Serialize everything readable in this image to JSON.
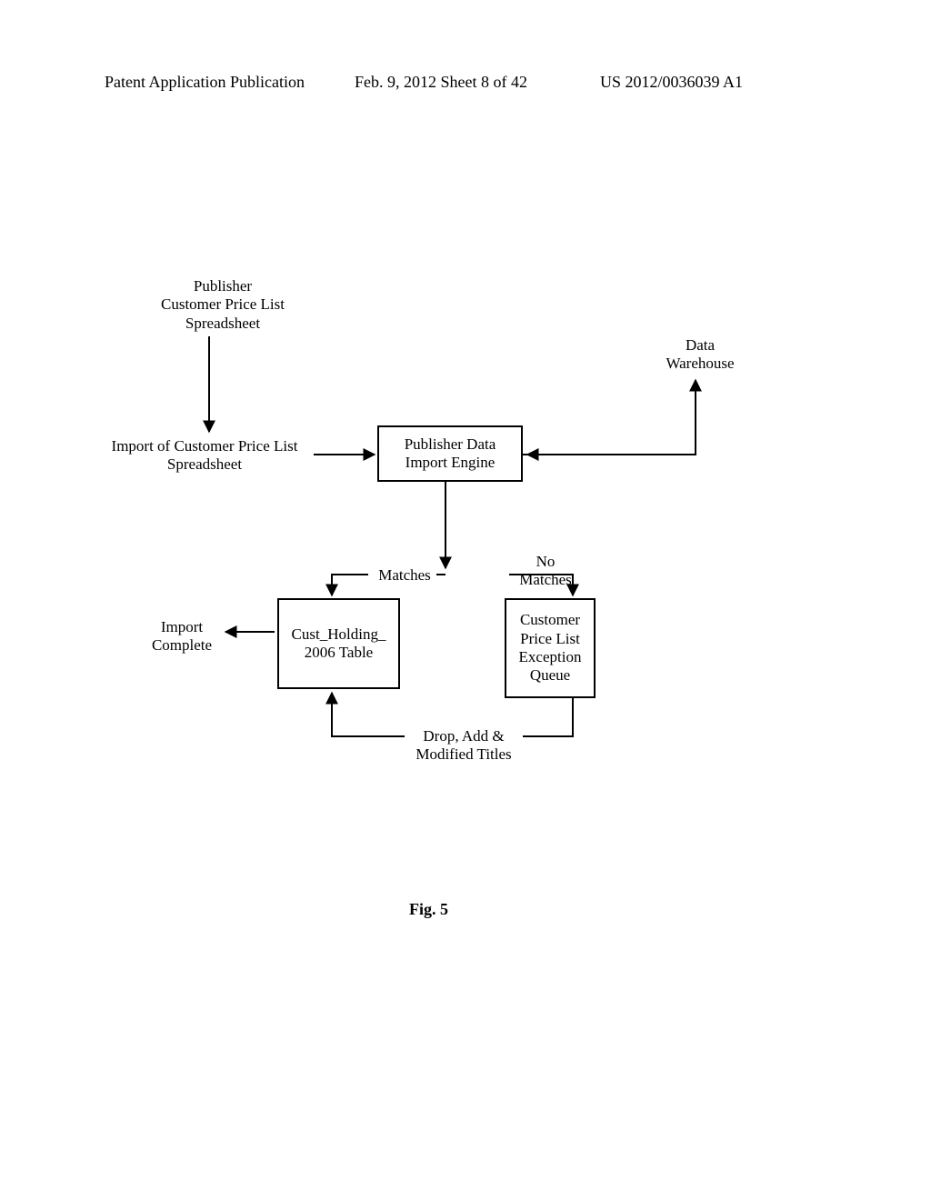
{
  "header": {
    "left": "Patent Application Publication",
    "mid": "Feb. 9, 2012  Sheet 8 of 42",
    "right": "US 2012/0036039 A1"
  },
  "labels": {
    "publisher_price_list": "Publisher\nCustomer Price List\nSpreadsheet",
    "data_warehouse": "Data\nWarehouse",
    "import_price_list": "Import of Customer Price List\nSpreadsheet",
    "import_complete": "Import\nComplete",
    "matches": "Matches",
    "no_matches": "No\nMatches",
    "drop_add": "Drop, Add &\nModified Titles"
  },
  "boxes": {
    "import_engine": "Publisher Data\nImport Engine",
    "cust_holding": "Cust_Holding_\n2006 Table",
    "exception_queue": "Customer\nPrice List\nException\nQueue"
  },
  "figure": "Fig. 5"
}
